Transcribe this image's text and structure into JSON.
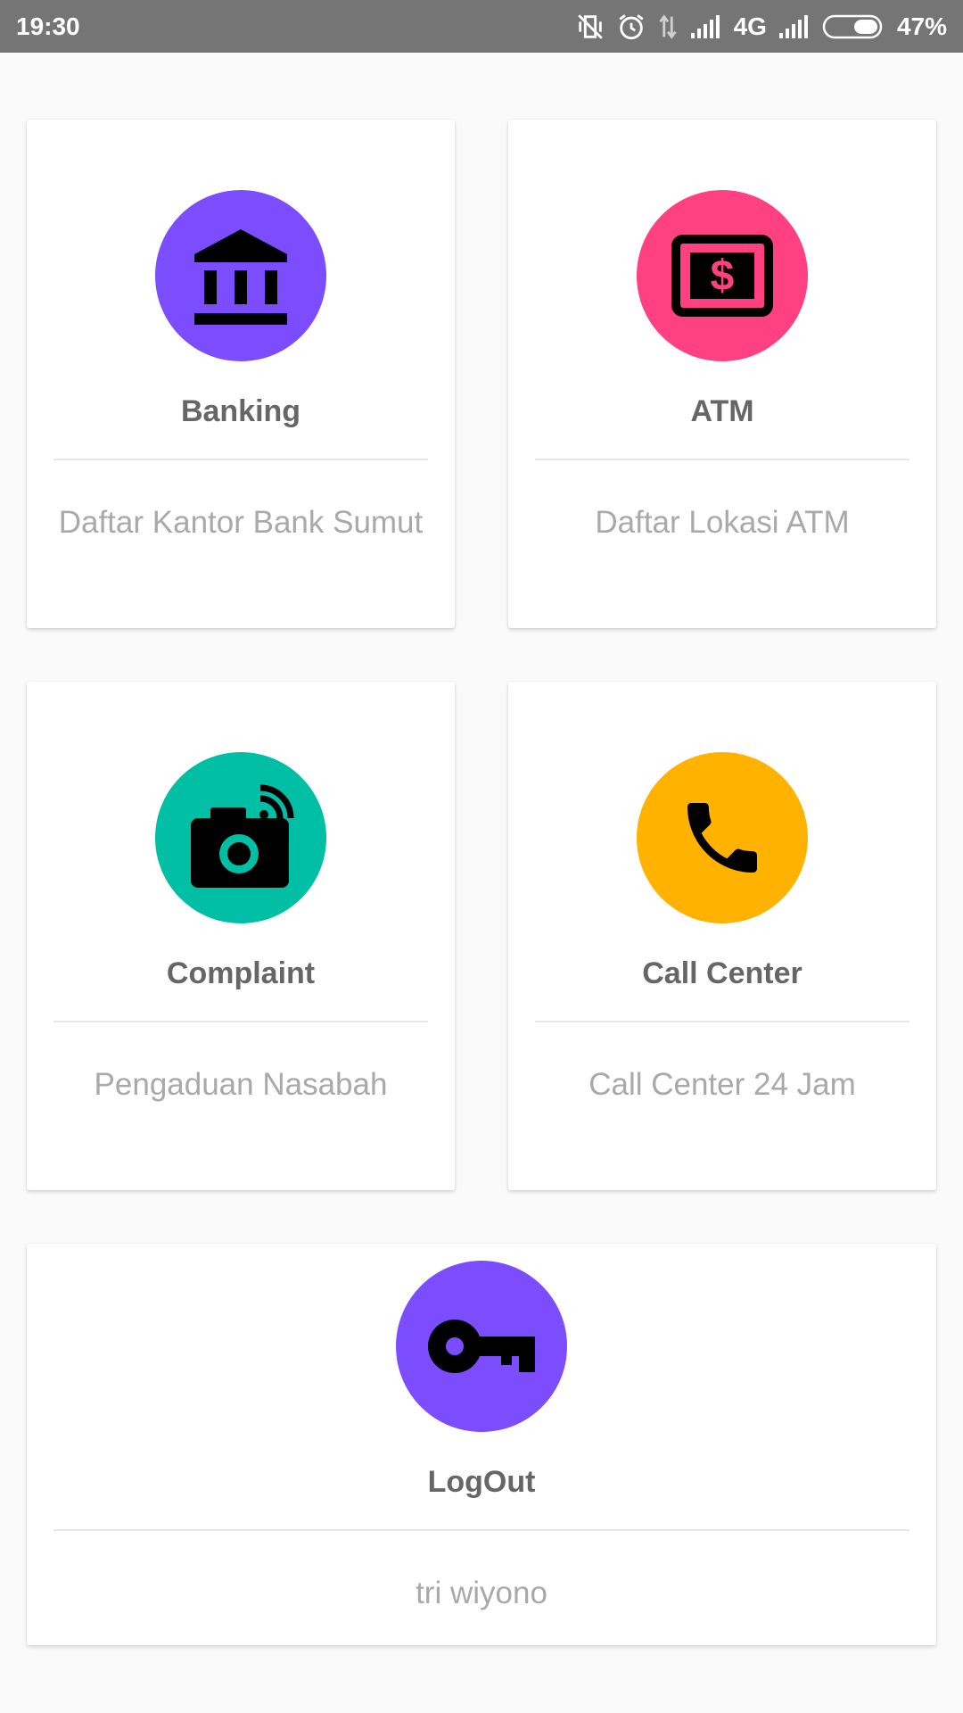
{
  "status_bar": {
    "time": "19:30",
    "network": "4G",
    "battery": "47%",
    "icons": [
      "vibrate-off-icon",
      "alarm-icon",
      "data-arrows-icon",
      "signal-icon",
      "signal-icon",
      "battery-icon"
    ]
  },
  "menu": {
    "banking": {
      "title": "Banking",
      "subtitle": "Daftar Kantor Bank Sumut",
      "icon": "bank-icon",
      "color": "#7c4dff"
    },
    "atm": {
      "title": "ATM",
      "subtitle": "Daftar Lokasi ATM",
      "icon": "atm-money-icon",
      "color": "#ff4081"
    },
    "complaint": {
      "title": "Complaint",
      "subtitle": "Pengaduan Nasabah",
      "icon": "camera-icon",
      "color": "#00bfa5"
    },
    "call_center": {
      "title": "Call Center",
      "subtitle": "Call Center 24 Jam",
      "icon": "phone-icon",
      "color": "#ffb300"
    },
    "logout": {
      "title": "LogOut",
      "subtitle": "tri wiyono",
      "icon": "key-icon",
      "color": "#7c4dff"
    }
  }
}
